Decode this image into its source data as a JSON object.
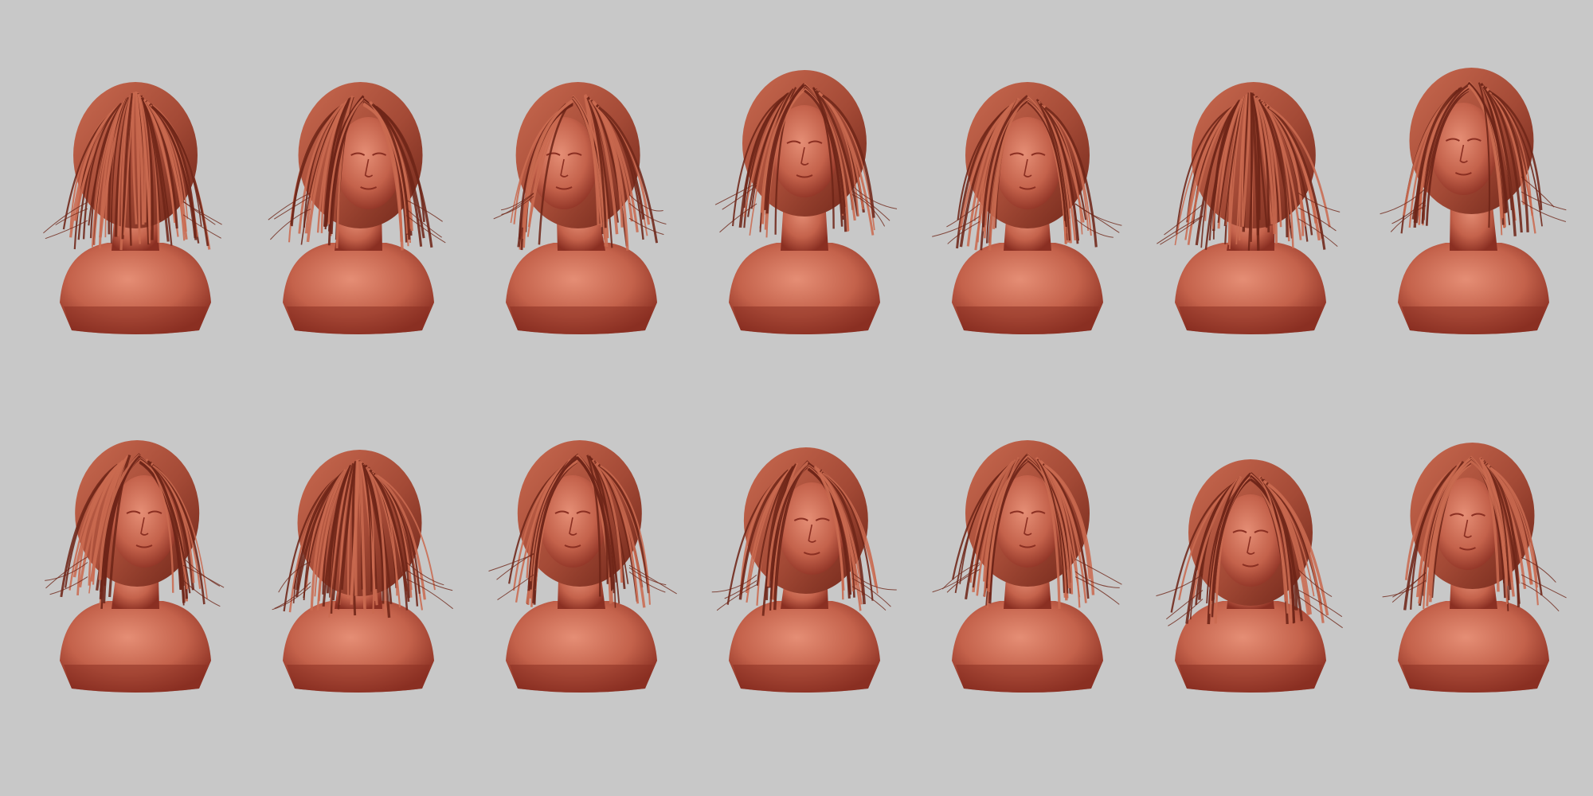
{
  "scene": {
    "background_color": "#c8c8c8",
    "clay_color": "#c4624b",
    "clay_shadow": "#8a2f22",
    "clay_highlight": "#e58e75",
    "hair_color": "#a44a36",
    "hair_dark": "#6e2518",
    "hair_light": "#c96a50"
  },
  "rows": [
    {
      "busts": [
        {
          "view": "back",
          "yaw": 180,
          "tilt": 0
        },
        {
          "view": "three-quarter-right",
          "yaw": 35,
          "tilt": 0
        },
        {
          "view": "profile-left",
          "yaw": -95,
          "tilt": 0
        },
        {
          "view": "low-front",
          "yaw": 0,
          "tilt": -25
        },
        {
          "view": "front",
          "yaw": 0,
          "tilt": 0
        },
        {
          "view": "profile-right-back",
          "yaw": 120,
          "tilt": 0
        },
        {
          "view": "tilted-left",
          "yaw": -35,
          "tilt": -30
        }
      ]
    },
    {
      "busts": [
        {
          "view": "three-quarter-right",
          "yaw": 30,
          "tilt": 0
        },
        {
          "view": "back-high",
          "yaw": 160,
          "tilt": 20
        },
        {
          "view": "three-quarter-left",
          "yaw": -30,
          "tilt": 0
        },
        {
          "view": "three-quarter-right-down",
          "yaw": 25,
          "tilt": 15
        },
        {
          "view": "front",
          "yaw": 0,
          "tilt": 0
        },
        {
          "view": "top-down",
          "yaw": 0,
          "tilt": 40
        },
        {
          "view": "three-quarter-left",
          "yaw": -20,
          "tilt": 5
        }
      ]
    }
  ]
}
